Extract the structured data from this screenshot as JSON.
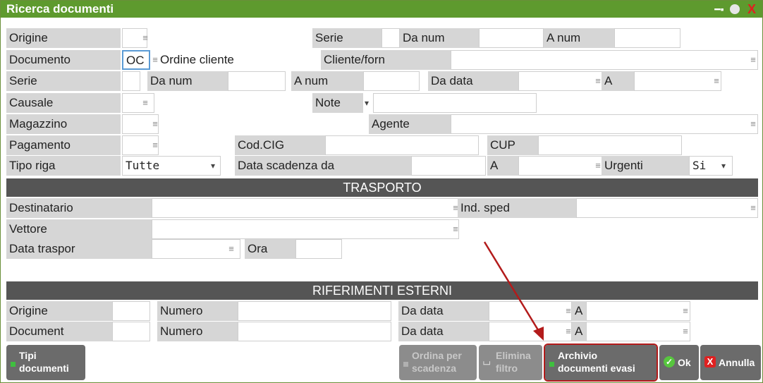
{
  "window": {
    "title": "Ricerca documenti",
    "pin_icon": "pin-icon",
    "circle_icon": "circle-icon",
    "close_icon": "close-icon"
  },
  "row1": {
    "origine": "Origine",
    "serie": "Serie",
    "da_num": "Da num",
    "a_num": "A num"
  },
  "row2": {
    "documento": "Documento",
    "doc_code": "OC",
    "doc_desc": "Ordine cliente",
    "cliente": "Cliente/forn"
  },
  "row3": {
    "serie": "Serie",
    "da_num": "Da num",
    "a_num": "A num",
    "da_data": "Da data",
    "a": "A"
  },
  "row4": {
    "causale": "Causale",
    "note": "Note"
  },
  "row5": {
    "magazzino": "Magazzino",
    "agente": "Agente"
  },
  "row6": {
    "pagamento": "Pagamento",
    "cig": "Cod.CIG",
    "cup": "CUP"
  },
  "row7": {
    "tipo_riga": "Tipo riga",
    "tipo_riga_value": "Tutte",
    "scadenza": "Data scadenza da",
    "a": "A",
    "urgenti": "Urgenti",
    "urgenti_value": "Si"
  },
  "trasporto": {
    "header": "TRASPORTO",
    "destinatario": "Destinatario",
    "ind_sped": "Ind. sped",
    "vettore": "Vettore",
    "data_traspor": "Data traspor",
    "ora": "Ora"
  },
  "riferimenti": {
    "header": "RIFERIMENTI ESTERNI",
    "origine": "Origine",
    "numero1": "Numero",
    "da_data1": "Da data",
    "a1": "A",
    "document": "Document",
    "numero2": "Numero",
    "da_data2": "Da data",
    "a2": "A"
  },
  "buttons": {
    "tipi_l1": "Tipi",
    "tipi_l2": "documenti",
    "ordina_l1": "Ordina per",
    "ordina_l2": "scadenza",
    "elimina_l1": "Elimina",
    "elimina_l2": "filtro",
    "archivio_l1": "Archivio",
    "archivio_l2": "documenti evasi",
    "ok": "Ok",
    "annulla": "Annulla"
  },
  "glyphs": {
    "lookup": "≡",
    "dropdown": "▾"
  },
  "colors": {
    "titlebar": "#5e9a2e",
    "section": "#555555",
    "focus": "#5b9bd5",
    "annotation_arrow": "#b31b1b"
  }
}
